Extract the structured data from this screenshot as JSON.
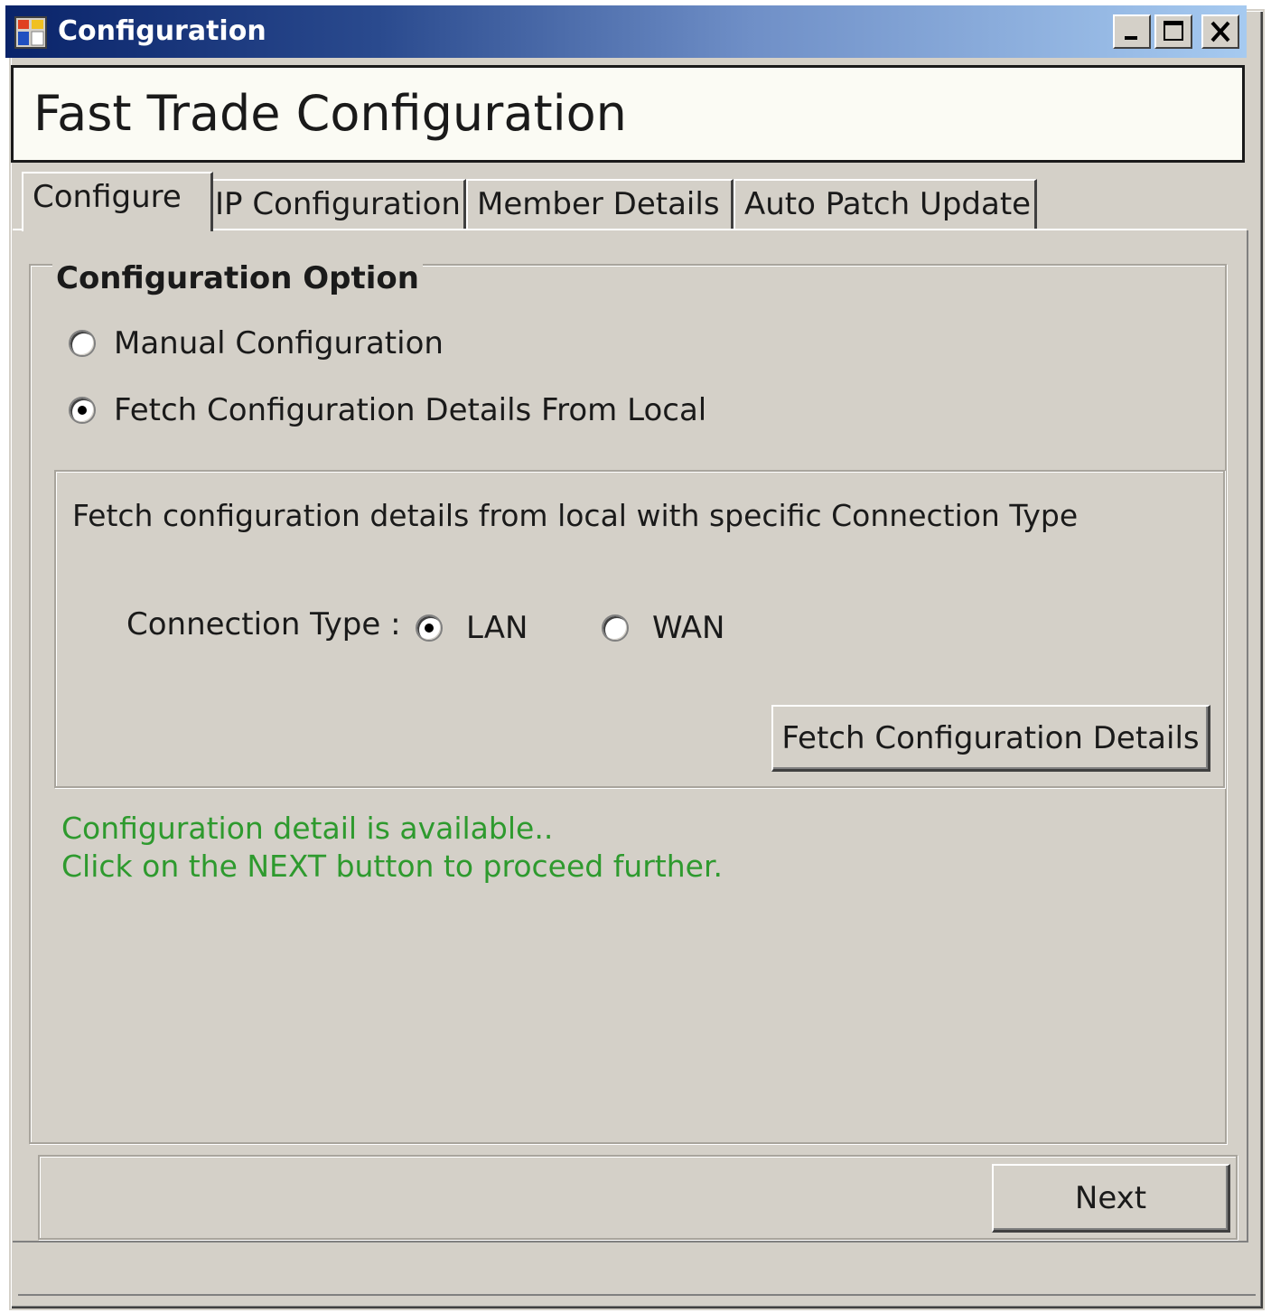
{
  "window": {
    "title": "Configuration",
    "controls": {
      "minimize": "minimize-icon",
      "maximize": "maximize-icon",
      "close": "close-icon"
    }
  },
  "header": {
    "title": "Fast Trade Configuration"
  },
  "tabs": [
    {
      "label": "Configure",
      "active": true
    },
    {
      "label": "IP Configuration",
      "active": false
    },
    {
      "label": "Member Details",
      "active": false
    },
    {
      "label": "Auto Patch Update",
      "active": false
    }
  ],
  "config_option": {
    "legend": "Configuration Option",
    "options": [
      {
        "label": "Manual Configuration",
        "checked": false
      },
      {
        "label": "Fetch Configuration Details From Local",
        "checked": true
      }
    ]
  },
  "fetch_panel": {
    "description": "Fetch configuration details from local with specific Connection Type",
    "connection_label": "Connection Type :",
    "connection_options": [
      {
        "label": "LAN",
        "checked": true
      },
      {
        "label": "WAN",
        "checked": false
      }
    ],
    "fetch_button": "Fetch Configuration Details"
  },
  "status": {
    "line1": "Configuration detail is available..",
    "line2": "Click on the NEXT button to proceed further.",
    "color": "#2e9a2e"
  },
  "footer": {
    "next_button": "Next"
  }
}
